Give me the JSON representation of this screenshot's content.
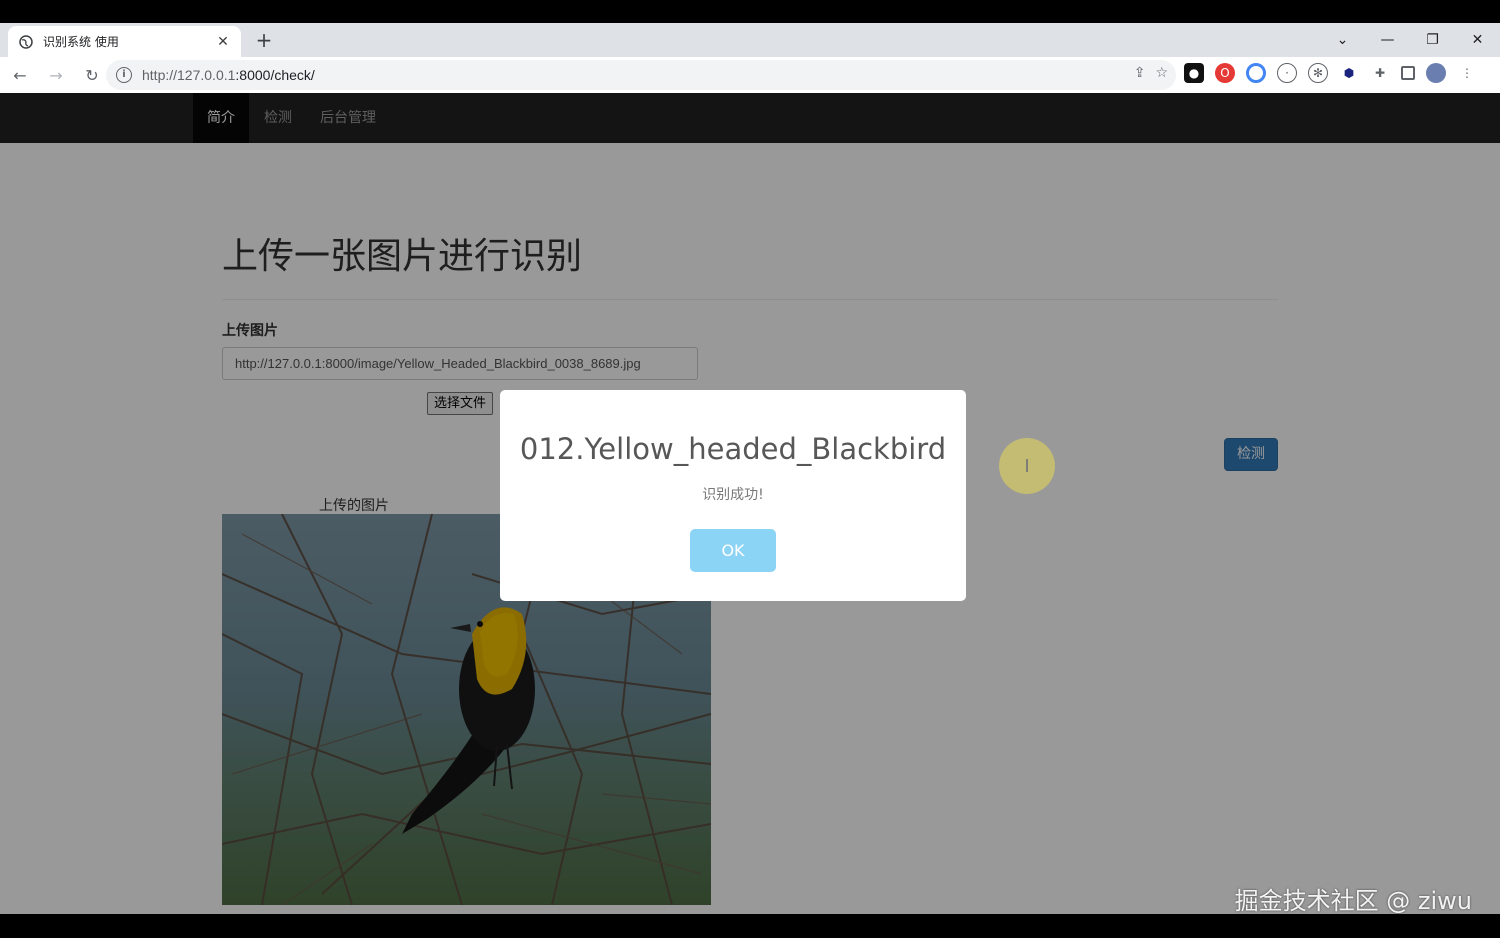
{
  "browser": {
    "tab_title": "识别系统 使用",
    "url_host": "http://127.0.0.1",
    "url_rest": ":8000/check/"
  },
  "navbar": {
    "items": [
      {
        "label": "简介",
        "active": true
      },
      {
        "label": "检测",
        "active": false
      },
      {
        "label": "后台管理",
        "active": false
      }
    ]
  },
  "main": {
    "heading": "上传一张图片进行识别",
    "upload_label": "上传图片",
    "upload_url_value": "http://127.0.0.1:8000/image/Yellow_Headed_Blackbird_0038_8689.jpg",
    "file_button_label": "选择文件",
    "detect_button_label": "检测",
    "image_caption": "上传的图片"
  },
  "dialog": {
    "title": "012.Yellow_headed_Blackbird",
    "text": "识别成功!",
    "ok_label": "OK"
  },
  "watermark": "掘金技术社区 @ ziwu",
  "colors": {
    "navbar_bg": "#222222",
    "primary_button": "#337ab7",
    "ok_button": "#8cd4f5"
  }
}
